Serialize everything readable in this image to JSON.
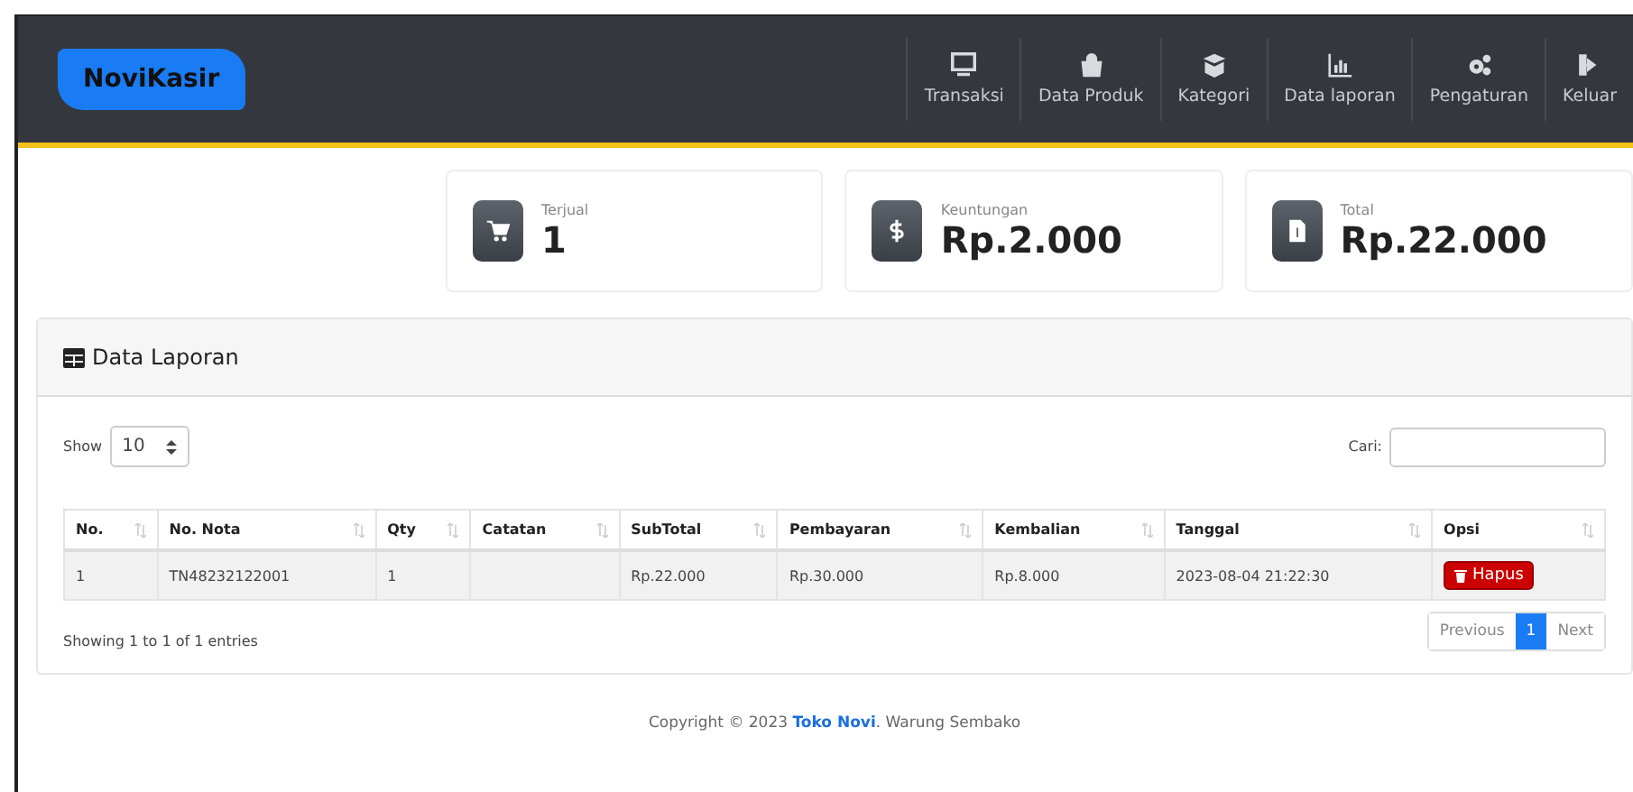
{
  "brand": "NoviKasir",
  "nav": [
    {
      "label": "Transaksi",
      "kind": "monitor"
    },
    {
      "label": "Data Produk",
      "kind": "bag"
    },
    {
      "label": "Kategori",
      "kind": "box"
    },
    {
      "label": "Data laporan",
      "kind": "chart"
    },
    {
      "label": "Pengaturan",
      "kind": "gears"
    },
    {
      "label": "Keluar",
      "kind": "logout"
    }
  ],
  "stats": [
    {
      "label": "Terjual",
      "value": "1",
      "kind": "cart"
    },
    {
      "label": "Keuntungan",
      "value": "Rp.2.000",
      "kind": "dollar"
    },
    {
      "label": "Total",
      "value": "Rp.22.000",
      "kind": "file"
    }
  ],
  "panel": {
    "title": "Data Laporan",
    "show_label": "Show",
    "page_size": "10",
    "search_label": "Cari:",
    "columns": [
      "No.",
      "No. Nota",
      "Qty",
      "Catatan",
      "SubTotal",
      "Pembayaran",
      "Kembalian",
      "Tanggal",
      "Opsi"
    ],
    "rows": [
      {
        "cells": [
          "1",
          "TN48232122001",
          "1",
          "",
          "Rp.22.000",
          "Rp.30.000",
          "Rp.8.000",
          "2023-08-04 21:22:30"
        ],
        "action": "Hapus"
      }
    ],
    "info": "Showing 1 to 1 of 1 entries",
    "pagination": [
      {
        "label": "Previous",
        "selected": false
      },
      {
        "label": "1",
        "selected": true
      },
      {
        "label": "Next",
        "selected": false
      }
    ]
  },
  "footer": {
    "prefix": "Copyright © 2023 ",
    "brand": "Toko Novi",
    "suffix": ". Warung Sembako"
  }
}
